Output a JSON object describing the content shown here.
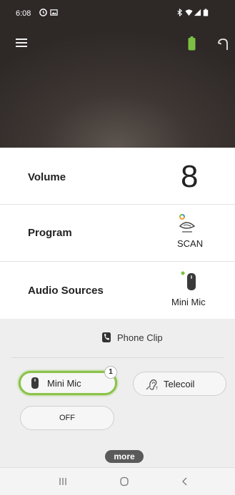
{
  "status_bar": {
    "time": "6:08",
    "icons": [
      "alarm-icon",
      "image-icon",
      "bluetooth-icon",
      "wifi-icon",
      "signal-icon",
      "battery-icon"
    ]
  },
  "header": {
    "menu_icon": "hamburger-menu-icon",
    "battery_icon": "hearing-aid-battery-icon",
    "battery_color": "#7bc043",
    "device_icon": "hearing-aid-icon"
  },
  "volume": {
    "label": "Volume",
    "value": "8"
  },
  "program": {
    "label": "Program",
    "value": "SCAN",
    "icon": "scan-program-icon"
  },
  "audio_sources": {
    "label": "Audio Sources",
    "value": "Mini Mic",
    "icon": "mini-mic-icon",
    "indicator_color": "#7bc043"
  },
  "panel": {
    "phone_clip": "Phone Clip",
    "sources": [
      {
        "label": "Mini Mic",
        "active": true,
        "badge": "1",
        "accent": "#8bc34a"
      },
      {
        "label": "Telecoil",
        "active": false
      }
    ],
    "off_label": "OFF",
    "more_label": "more"
  },
  "navbar": {
    "items": [
      "recent-apps-icon",
      "home-icon",
      "back-icon"
    ]
  }
}
